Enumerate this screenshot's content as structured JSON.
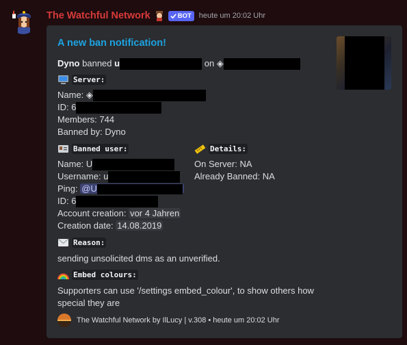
{
  "message": {
    "author": "The Watchful Network",
    "bot_tag": "BOT",
    "timestamp": "heute um 20:02 Uhr"
  },
  "embed": {
    "title": "A new ban notification!",
    "summary": {
      "actor": "Dyno",
      "verb": "banned",
      "user_prefix": "u",
      "on": "on",
      "server_glyph": "◈"
    },
    "server": {
      "label": "Server:",
      "name_label": "Name:",
      "name_prefix": "◈",
      "id_label": "ID:",
      "id_prefix": "6",
      "members_line": "Members: 744",
      "banned_by_line": "Banned by: Dyno"
    },
    "banned_user": {
      "label": "Banned user:",
      "name_label": "Name:",
      "name_prefix": "U",
      "username_label": "Username:",
      "username_prefix": "u",
      "ping_label": "Ping:",
      "ping_prefix": "@U",
      "id_label": "ID:",
      "id_prefix": "6",
      "account_creation_label": "Account creation:",
      "account_creation_value": "vor 4 Jahren",
      "creation_date_label": "Creation date:",
      "creation_date_value": "14.08.2019"
    },
    "details": {
      "label": "Details:",
      "on_server": "On Server: NA",
      "already_banned": "Already Banned: NA"
    },
    "reason": {
      "label": "Reason:",
      "text": "sending unsolicited dms as an unverified."
    },
    "embed_colours": {
      "label": "Embed colours:",
      "text_line1": "Supporters can use '/settings embed_colour', to show others how",
      "text_line2": "special they are"
    },
    "footer": "The Watchful Network by IlLucy | v.308 • heute um 20:02 Uhr"
  },
  "icons": [
    "police-avatar-icon",
    "detective-emoji-icon",
    "checkmark-icon",
    "computer-icon",
    "id-card-icon",
    "ruler-icon",
    "envelope-icon",
    "rainbow-icon",
    "sunset-footer-icon"
  ],
  "colors": {
    "background": "#1e0c0f",
    "embed_bg": "#2b2d31",
    "title": "#1da3e0",
    "author": "#d83a3a",
    "bot_tag": "#5865f2"
  }
}
